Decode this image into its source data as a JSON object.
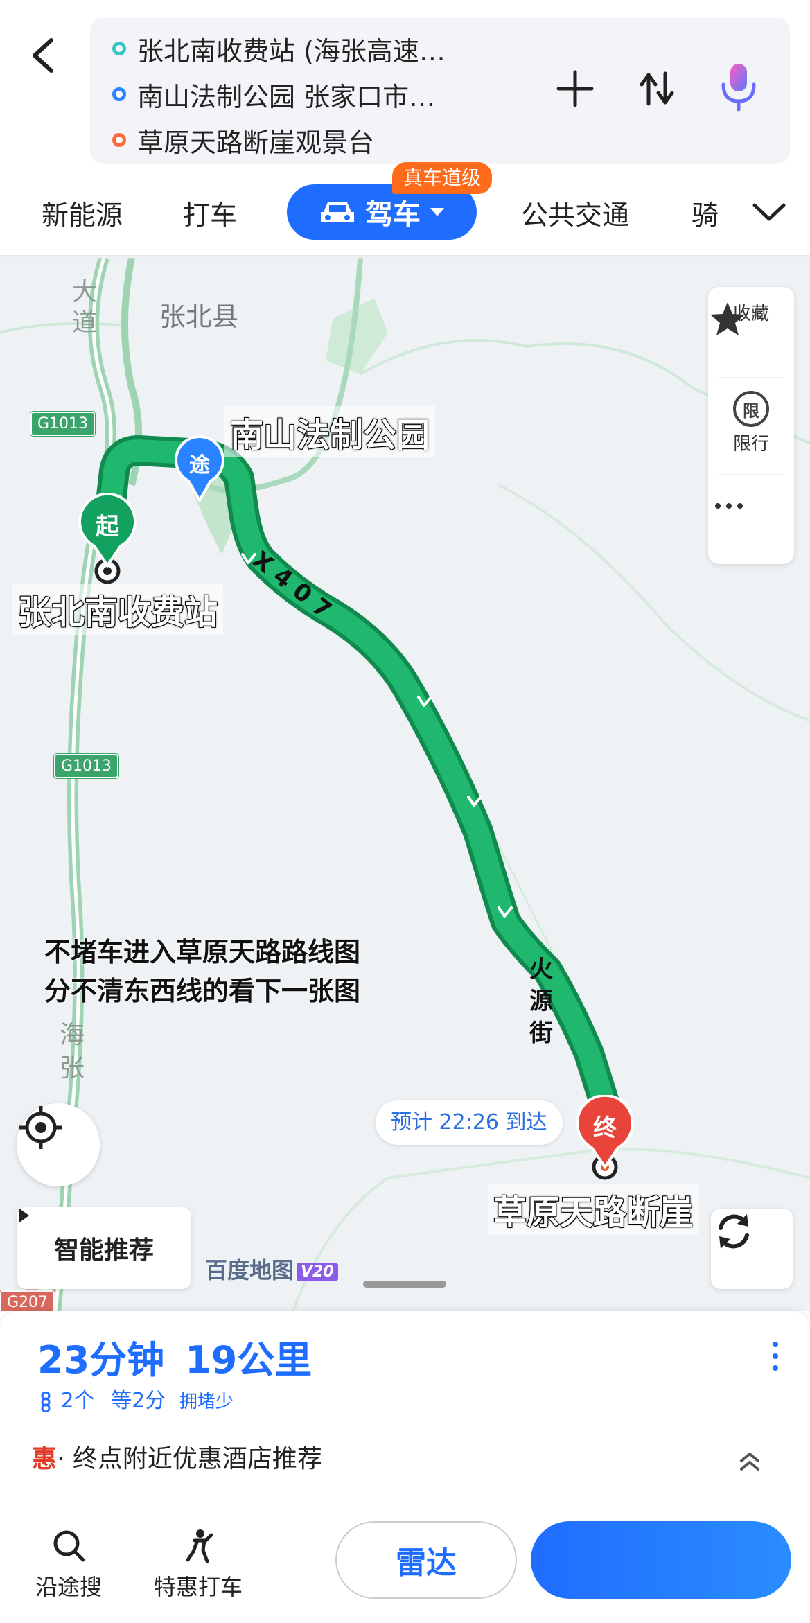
{
  "route": {
    "start": "张北南收费站 (海张高速…",
    "via": "南山法制公园 张家口市…",
    "end": "草原天路断崖观景台"
  },
  "tabs": {
    "new_energy": "新能源",
    "taxi": "打车",
    "drive": "驾车",
    "drive_badge": "真车道级",
    "transit": "公共交通",
    "ride": "骑"
  },
  "map": {
    "place_zhangbei": "张北县",
    "road_dadao": "大道",
    "road_haizhang": "海张",
    "shield_g1013_a": "G1013",
    "shield_g1013_b": "G1013",
    "shield_g207": "G207",
    "road_x407": "X 4 0 7",
    "road_huoyuan": "火源街",
    "label_via": "南山法制公园",
    "label_start": "张北南收费站",
    "label_end": "草原天路断崖",
    "pin_start": "起",
    "pin_via": "途",
    "pin_end": "终",
    "eta": "预计 22:26 到达",
    "caption_line1": "不堵车进入草原天路路线图",
    "caption_line2": "分不清东西线的看下一张图",
    "watermark": "百度地图",
    "watermark_badge": "V20",
    "route_color": "#1fa96a"
  },
  "side_panel": {
    "favorite": "收藏",
    "restrict_icon": "限",
    "restrict": "限行"
  },
  "smart_recommend": "智能推荐",
  "summary": {
    "time": "23分钟",
    "distance": "19公里",
    "lights": "2个",
    "wait": "等2分",
    "congestion": "拥堵少"
  },
  "promo": {
    "prefix": "惠",
    "text": "· 终点附近优惠酒店推荐"
  },
  "bottom": {
    "search_along": "沿途搜",
    "discount_taxi": "特惠打车",
    "radar": "雷达"
  }
}
